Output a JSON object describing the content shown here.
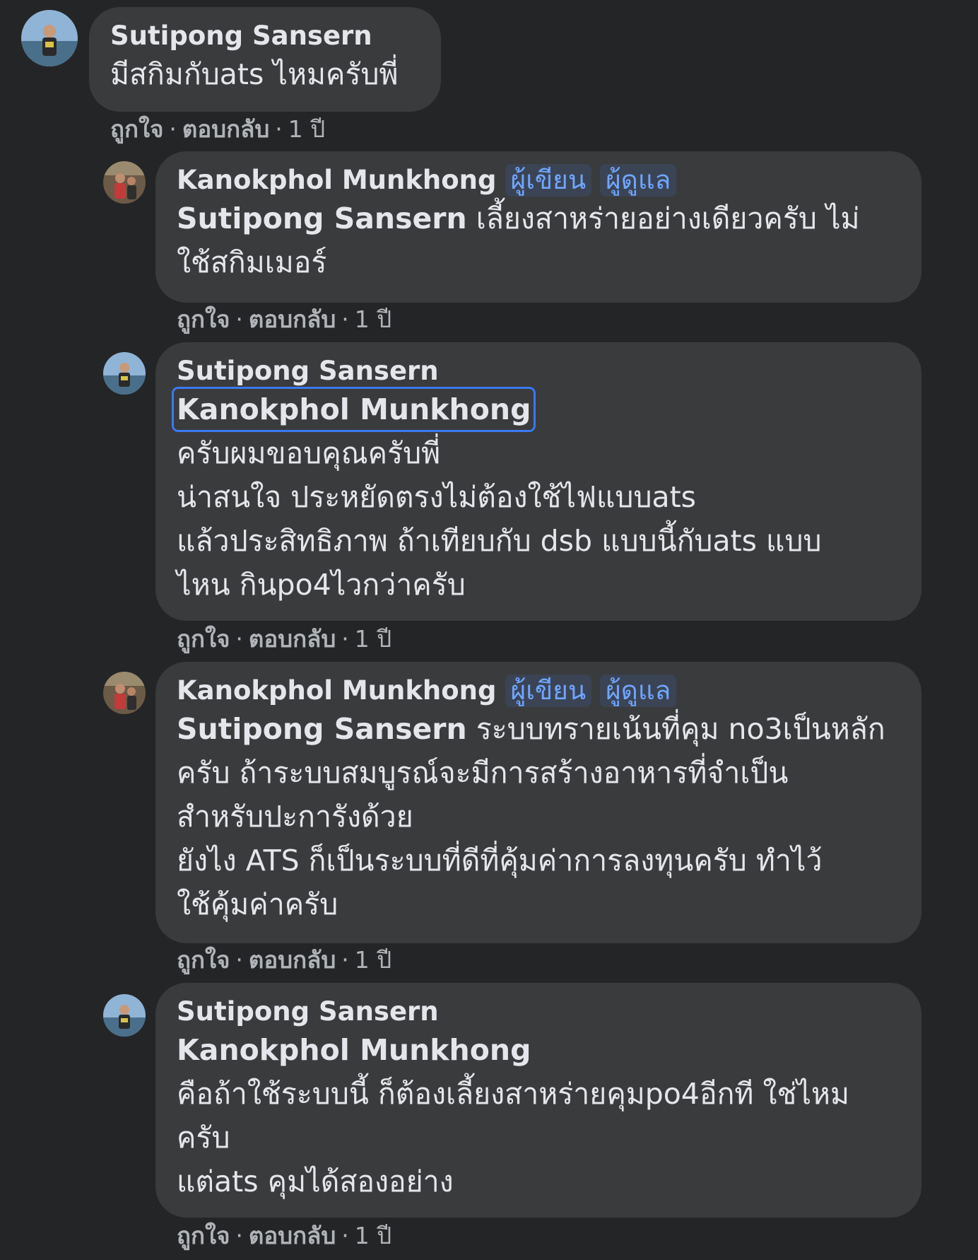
{
  "comments": [
    {
      "author": "Sutipong Sansern",
      "lines": [
        "มีสกิมกับats ไหมครับพี่"
      ],
      "actions": {
        "like": "ถูกใจ",
        "reply": "ตอบกลับ",
        "time": "1 ปี"
      }
    },
    {
      "author": "Kanokphol Munkhong",
      "badges": [
        "ผู้เขียน",
        "ผู้ดูแล"
      ],
      "mention": "Sutipong Sansern",
      "lines": [
        " เลี้ยงสาหร่ายอย่างเดียวครับ ไม่",
        "ใช้สกิมเมอร์"
      ],
      "actions": {
        "like": "ถูกใจ",
        "reply": "ตอบกลับ",
        "time": "1 ปี"
      }
    },
    {
      "author": "Sutipong Sansern",
      "mention": "Kanokphol Munkhong",
      "lines": [
        "ครับผมขอบคุณครับพี่",
        "น่าสนใจ ประหยัดตรงไม่ต้องใช้ไฟแบบats",
        "แล้วประสิทธิภาพ ถ้าเทียบกับ dsb แบบนี้กับats แบบ",
        "ไหน กินpo4ไวกว่าครับ"
      ],
      "actions": {
        "like": "ถูกใจ",
        "reply": "ตอบกลับ",
        "time": "1 ปี"
      }
    },
    {
      "author": "Kanokphol Munkhong",
      "badges": [
        "ผู้เขียน",
        "ผู้ดูแล"
      ],
      "mention": "Sutipong Sansern",
      "lines": [
        " ระบบทรายเน้นที่คุม no3เป็นหลัก",
        "ครับ ถ้าระบบสมบูรณ์จะมีการสร้างอาหารที่จำเป็น",
        "สำหรับปะการังด้วย",
        "ยังไง ATS ก็เป็นระบบที่ดีที่คุ้มค่าการลงทุนครับ ทำไว้",
        "ใช้คุ้มค่าครับ"
      ],
      "actions": {
        "like": "ถูกใจ",
        "reply": "ตอบกลับ",
        "time": "1 ปี"
      }
    },
    {
      "author": "Sutipong Sansern",
      "mention": "Kanokphol Munkhong",
      "lines": [
        "คือถ้าใช้ระบบนี้ ก็ต้องเลี้ยงสาหร่ายคุมpo4อีกที ใช่ไหม",
        "ครับ",
        "แต่ats คุมได้สองอย่าง"
      ],
      "actions": {
        "like": "ถูกใจ",
        "reply": "ตอบกลับ",
        "time": "1 ปี"
      }
    }
  ],
  "separator": "·"
}
